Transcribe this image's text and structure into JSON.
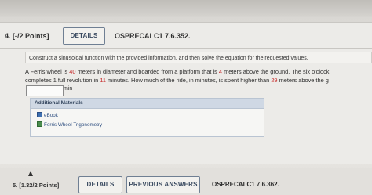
{
  "question": {
    "number_label": "4.  [-/2 Points]",
    "details_label": "DETAILS",
    "code": "OSPRECALC1 7.6.352.",
    "instructions": "Construct a sinusoidal function with the provided information, and then solve the equation for the requested values.",
    "problem": {
      "t1": "A Ferris wheel is ",
      "diameter": "40",
      "t2": " meters in diameter and boarded from a platform that is ",
      "height": "4",
      "t3": " meters above the ground. The six o'clock",
      "t4": "completes 1 full revolution in ",
      "minutes": "11",
      "t5": " minutes. How much of the ride, in minutes, is spent higher than ",
      "threshold": "29",
      "t6": " meters above the g"
    },
    "answer": {
      "value": "",
      "unit": "min"
    },
    "materials": {
      "title": "Additional Materials",
      "items": [
        "eBook",
        "Ferris Wheel Trigonometry"
      ]
    }
  },
  "next_question": {
    "number_label": "5.  [1.32/2 Points]",
    "details_label": "DETAILS",
    "previous_answers_label": "PREVIOUS ANSWERS",
    "code": "OSPRECALC1 7.6.362."
  },
  "colors": {
    "highlight_red": "#c62828",
    "button_border": "#6f7f93",
    "materials_header": "#cfd8e4"
  },
  "icons": [
    "ebook-icon",
    "tutorial-icon",
    "mouse-cursor-icon"
  ]
}
